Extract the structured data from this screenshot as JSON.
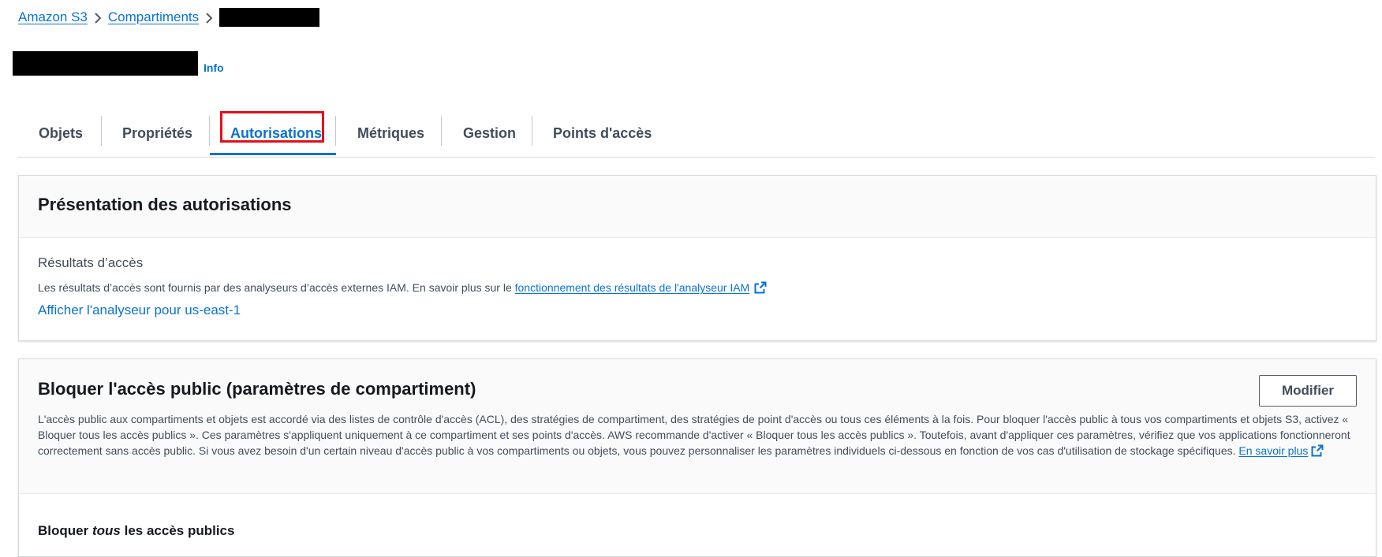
{
  "breadcrumb": {
    "items": [
      "Amazon S3",
      "Compartiments"
    ],
    "current_redacted": true
  },
  "header": {
    "title_redacted": true,
    "info_label": "Info"
  },
  "tabs": [
    {
      "label": "Objets",
      "active": false
    },
    {
      "label": "Propriétés",
      "active": false
    },
    {
      "label": "Autorisations",
      "active": true
    },
    {
      "label": "Métriques",
      "active": false
    },
    {
      "label": "Gestion",
      "active": false
    },
    {
      "label": "Points d'accès",
      "active": false
    }
  ],
  "permissions_overview": {
    "title": "Présentation des autorisations",
    "subtitle": "Résultats d’accès",
    "description": "Les résultats d’accès sont fournis par des analyseurs d’accès externes IAM. En savoir plus sur le",
    "link_label": "fonctionnement des résultats de l'analyseur IAM",
    "analyser_link": "Afficher l'analyseur pour us-east-1"
  },
  "block_public_access": {
    "title": "Bloquer l'accès public (paramètres de compartiment)",
    "modify_label": "Modifier",
    "description": "L'accès public aux compartiments et objets est accordé via des listes de contrôle d'accès (ACL), des stratégies de compartiment, des stratégies de point d'accès ou tous ces éléments à la fois. Pour bloquer l'accès public à tous vos compartiments et objets S3, activez « Bloquer tous les accès publics ». Ces paramètres s'appliquent uniquement à ce compartiment et ses points d'accès. AWS recommande d'activer « Bloquer tous les accès publics ». Toutefois, avant d'appliquer ces paramètres, vérifiez que vos applications fonctionneront correctement sans accès public. Si vous avez besoin d'un certain niveau d'accès public à vos compartiments ou objets, vous pouvez personnaliser les paramètres individuels ci-dessous en fonction de vos cas d'utilisation de stockage spécifiques.",
    "learn_more": "En savoir plus",
    "block_all_prefix": "Bloquer",
    "block_all_emph": "tous",
    "block_all_suffix": "les accès publics"
  },
  "colors": {
    "link": "#0972d3",
    "highlight": "#e3101e",
    "text": "#16191f"
  }
}
